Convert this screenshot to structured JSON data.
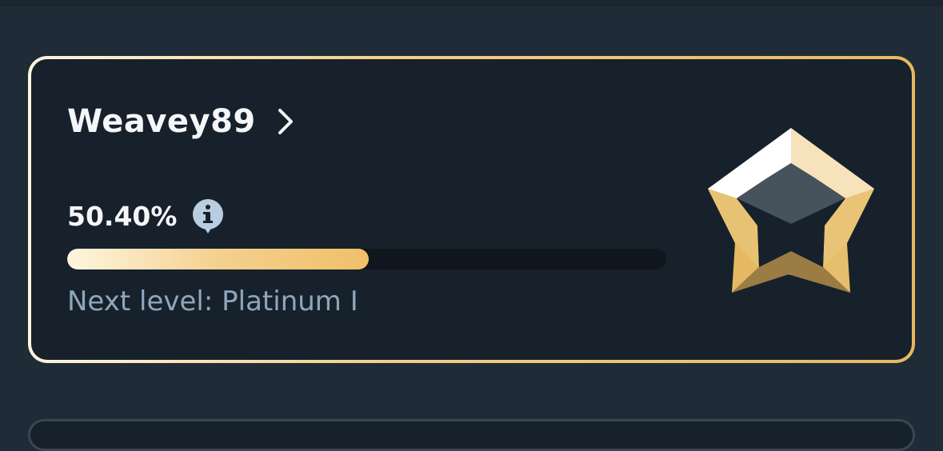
{
  "profile": {
    "username": "Weavey89",
    "percent_text": "50.40%",
    "progress": 0.504,
    "next_level_text": "Next level: Platinum I"
  },
  "icons": {
    "profile_link": "chevron-right-icon",
    "info": "info-icon",
    "rank_badge": "gold-star-icon"
  },
  "colors": {
    "background": "#1f2c38",
    "card": "#17212b",
    "gold_accent": "#f0c068",
    "text_primary": "#f4f6f8",
    "text_secondary": "#8fa6bb"
  }
}
